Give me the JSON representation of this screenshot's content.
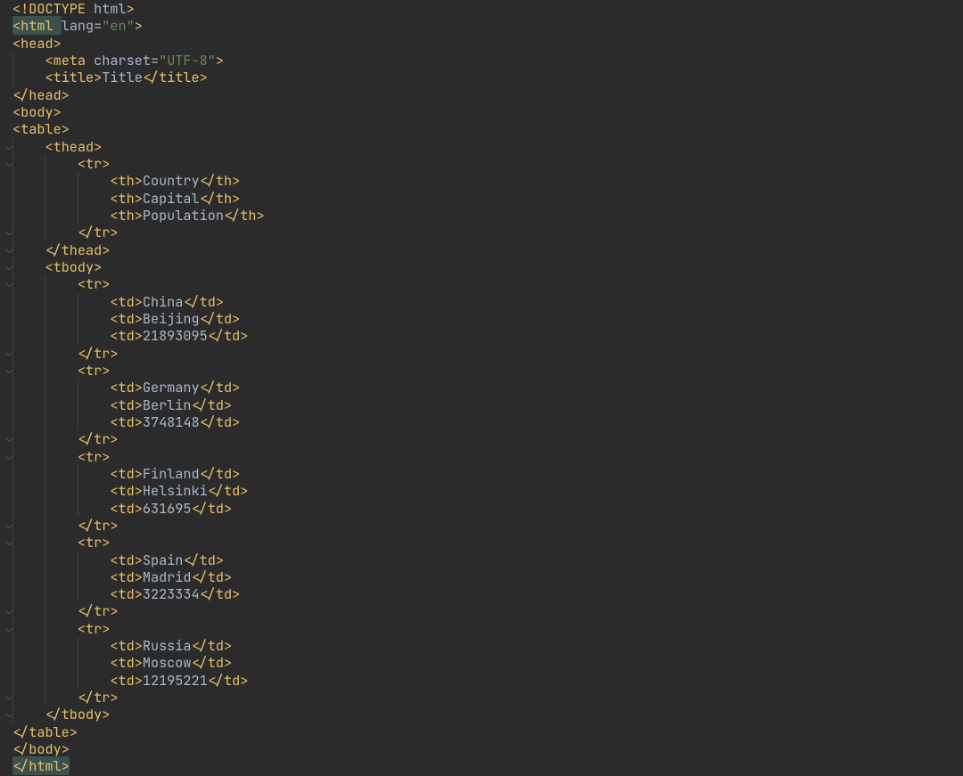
{
  "indentUnit": "    ",
  "lines": [
    {
      "indent": 0,
      "gutter": "",
      "tokens": [
        {
          "cls": "tag-punc",
          "t": "<!"
        },
        {
          "cls": "tag-name",
          "t": "DOCTYPE "
        },
        {
          "cls": "attr-name",
          "t": "html"
        },
        {
          "cls": "tag-punc",
          "t": ">"
        }
      ]
    },
    {
      "indent": 0,
      "gutter": "",
      "tokens": [
        {
          "cls": "hl-open",
          "wrap": [
            {
              "cls": "tag-punc",
              "t": "<"
            },
            {
              "cls": "tag-name",
              "t": "html "
            }
          ]
        },
        {
          "cls": "attr-name",
          "t": "lang"
        },
        {
          "cls": "attr-eq",
          "t": "="
        },
        {
          "cls": "attr-val",
          "t": "\"en\""
        },
        {
          "cls": "tag-punc",
          "t": ">"
        }
      ]
    },
    {
      "indent": 0,
      "gutter": "",
      "tokens": [
        {
          "cls": "tag-punc",
          "t": "<"
        },
        {
          "cls": "tag-name",
          "t": "head"
        },
        {
          "cls": "tag-punc",
          "t": ">"
        }
      ]
    },
    {
      "indent": 1,
      "gutter": "",
      "tokens": [
        {
          "cls": "tag-punc",
          "t": "<"
        },
        {
          "cls": "tag-name",
          "t": "meta "
        },
        {
          "cls": "attr-name",
          "t": "charset"
        },
        {
          "cls": "attr-eq",
          "t": "="
        },
        {
          "cls": "attr-val",
          "t": "\"UTF-8\""
        },
        {
          "cls": "tag-punc",
          "t": ">"
        }
      ]
    },
    {
      "indent": 1,
      "gutter": "",
      "tokens": [
        {
          "cls": "tag-punc",
          "t": "<"
        },
        {
          "cls": "tag-name",
          "t": "title"
        },
        {
          "cls": "tag-punc",
          "t": ">"
        },
        {
          "cls": "text-content",
          "t": "Title"
        },
        {
          "cls": "tag-punc",
          "t": "</"
        },
        {
          "cls": "tag-name",
          "t": "title"
        },
        {
          "cls": "tag-punc",
          "t": ">"
        }
      ]
    },
    {
      "indent": 0,
      "gutter": "",
      "tokens": [
        {
          "cls": "tag-punc",
          "t": "</"
        },
        {
          "cls": "tag-name",
          "t": "head"
        },
        {
          "cls": "tag-punc",
          "t": ">"
        }
      ]
    },
    {
      "indent": 0,
      "gutter": "",
      "tokens": [
        {
          "cls": "tag-punc",
          "t": "<"
        },
        {
          "cls": "tag-name",
          "t": "body"
        },
        {
          "cls": "tag-punc",
          "t": ">"
        }
      ]
    },
    {
      "indent": 0,
      "gutter": "",
      "tokens": [
        {
          "cls": "tag-punc",
          "t": "<"
        },
        {
          "cls": "tag-name",
          "t": "table"
        },
        {
          "cls": "tag-punc",
          "t": ">"
        }
      ]
    },
    {
      "indent": 1,
      "gutter": "⌄",
      "tokens": [
        {
          "cls": "tag-punc",
          "t": "<"
        },
        {
          "cls": "tag-name",
          "t": "thead"
        },
        {
          "cls": "tag-punc",
          "t": ">"
        }
      ]
    },
    {
      "indent": 2,
      "gutter": "⌄",
      "tokens": [
        {
          "cls": "tag-punc",
          "t": "<"
        },
        {
          "cls": "tag-name",
          "t": "tr"
        },
        {
          "cls": "tag-punc",
          "t": ">"
        }
      ]
    },
    {
      "indent": 3,
      "gutter": "",
      "tokens": [
        {
          "cls": "tag-punc",
          "t": "<"
        },
        {
          "cls": "tag-name",
          "t": "th"
        },
        {
          "cls": "tag-punc",
          "t": ">"
        },
        {
          "cls": "text-content",
          "t": "Country"
        },
        {
          "cls": "tag-punc",
          "t": "</"
        },
        {
          "cls": "tag-name",
          "t": "th"
        },
        {
          "cls": "tag-punc",
          "t": ">"
        }
      ]
    },
    {
      "indent": 3,
      "gutter": "",
      "tokens": [
        {
          "cls": "tag-punc",
          "t": "<"
        },
        {
          "cls": "tag-name",
          "t": "th"
        },
        {
          "cls": "tag-punc",
          "t": ">"
        },
        {
          "cls": "text-content",
          "t": "Capital"
        },
        {
          "cls": "tag-punc",
          "t": "</"
        },
        {
          "cls": "tag-name",
          "t": "th"
        },
        {
          "cls": "tag-punc",
          "t": ">"
        }
      ]
    },
    {
      "indent": 3,
      "gutter": "",
      "tokens": [
        {
          "cls": "tag-punc",
          "t": "<"
        },
        {
          "cls": "tag-name",
          "t": "th"
        },
        {
          "cls": "tag-punc",
          "t": ">"
        },
        {
          "cls": "text-content",
          "t": "Population"
        },
        {
          "cls": "tag-punc",
          "t": "</"
        },
        {
          "cls": "tag-name",
          "t": "th"
        },
        {
          "cls": "tag-punc",
          "t": ">"
        }
      ]
    },
    {
      "indent": 2,
      "gutter": "⌄",
      "tokens": [
        {
          "cls": "tag-punc",
          "t": "</"
        },
        {
          "cls": "tag-name",
          "t": "tr"
        },
        {
          "cls": "tag-punc",
          "t": ">"
        }
      ]
    },
    {
      "indent": 1,
      "gutter": "⌄",
      "tokens": [
        {
          "cls": "tag-punc",
          "t": "</"
        },
        {
          "cls": "tag-name",
          "t": "thead"
        },
        {
          "cls": "tag-punc",
          "t": ">"
        }
      ]
    },
    {
      "indent": 1,
      "gutter": "⌄",
      "tokens": [
        {
          "cls": "tag-punc",
          "t": "<"
        },
        {
          "cls": "tag-name",
          "t": "tbody"
        },
        {
          "cls": "tag-punc",
          "t": ">"
        }
      ]
    },
    {
      "indent": 2,
      "gutter": "⌄",
      "tokens": [
        {
          "cls": "tag-punc",
          "t": "<"
        },
        {
          "cls": "tag-name",
          "t": "tr"
        },
        {
          "cls": "tag-punc",
          "t": ">"
        }
      ]
    },
    {
      "indent": 3,
      "gutter": "",
      "tokens": [
        {
          "cls": "tag-punc",
          "t": "<"
        },
        {
          "cls": "tag-name",
          "t": "td"
        },
        {
          "cls": "tag-punc",
          "t": ">"
        },
        {
          "cls": "text-content",
          "t": "China"
        },
        {
          "cls": "tag-punc",
          "t": "</"
        },
        {
          "cls": "tag-name",
          "t": "td"
        },
        {
          "cls": "tag-punc",
          "t": ">"
        }
      ]
    },
    {
      "indent": 3,
      "gutter": "",
      "tokens": [
        {
          "cls": "tag-punc",
          "t": "<"
        },
        {
          "cls": "tag-name",
          "t": "td"
        },
        {
          "cls": "tag-punc",
          "t": ">"
        },
        {
          "cls": "text-content",
          "t": "Beijing"
        },
        {
          "cls": "tag-punc",
          "t": "</"
        },
        {
          "cls": "tag-name",
          "t": "td"
        },
        {
          "cls": "tag-punc",
          "t": ">"
        }
      ]
    },
    {
      "indent": 3,
      "gutter": "",
      "tokens": [
        {
          "cls": "tag-punc",
          "t": "<"
        },
        {
          "cls": "tag-name",
          "t": "td"
        },
        {
          "cls": "tag-punc",
          "t": ">"
        },
        {
          "cls": "text-content",
          "t": "21893095"
        },
        {
          "cls": "tag-punc",
          "t": "</"
        },
        {
          "cls": "tag-name",
          "t": "td"
        },
        {
          "cls": "tag-punc",
          "t": ">"
        }
      ]
    },
    {
      "indent": 2,
      "gutter": "⌄",
      "tokens": [
        {
          "cls": "tag-punc",
          "t": "</"
        },
        {
          "cls": "tag-name",
          "t": "tr"
        },
        {
          "cls": "tag-punc",
          "t": ">"
        }
      ]
    },
    {
      "indent": 2,
      "gutter": "⌄",
      "tokens": [
        {
          "cls": "tag-punc",
          "t": "<"
        },
        {
          "cls": "tag-name",
          "t": "tr"
        },
        {
          "cls": "tag-punc",
          "t": ">"
        }
      ]
    },
    {
      "indent": 3,
      "gutter": "",
      "tokens": [
        {
          "cls": "tag-punc",
          "t": "<"
        },
        {
          "cls": "tag-name",
          "t": "td"
        },
        {
          "cls": "tag-punc",
          "t": ">"
        },
        {
          "cls": "text-content",
          "t": "Germany"
        },
        {
          "cls": "tag-punc",
          "t": "</"
        },
        {
          "cls": "tag-name",
          "t": "td"
        },
        {
          "cls": "tag-punc",
          "t": ">"
        }
      ]
    },
    {
      "indent": 3,
      "gutter": "",
      "tokens": [
        {
          "cls": "tag-punc",
          "t": "<"
        },
        {
          "cls": "tag-name",
          "t": "td"
        },
        {
          "cls": "tag-punc",
          "t": ">"
        },
        {
          "cls": "text-content",
          "t": "Berlin"
        },
        {
          "cls": "tag-punc",
          "t": "</"
        },
        {
          "cls": "tag-name",
          "t": "td"
        },
        {
          "cls": "tag-punc",
          "t": ">"
        }
      ]
    },
    {
      "indent": 3,
      "gutter": "",
      "tokens": [
        {
          "cls": "tag-punc",
          "t": "<"
        },
        {
          "cls": "tag-name",
          "t": "td"
        },
        {
          "cls": "tag-punc",
          "t": ">"
        },
        {
          "cls": "text-content",
          "t": "3748148"
        },
        {
          "cls": "tag-punc",
          "t": "</"
        },
        {
          "cls": "tag-name",
          "t": "td"
        },
        {
          "cls": "tag-punc",
          "t": ">"
        }
      ]
    },
    {
      "indent": 2,
      "gutter": "⌄",
      "tokens": [
        {
          "cls": "tag-punc",
          "t": "</"
        },
        {
          "cls": "tag-name",
          "t": "tr"
        },
        {
          "cls": "tag-punc",
          "t": ">"
        }
      ]
    },
    {
      "indent": 2,
      "gutter": "⌄",
      "tokens": [
        {
          "cls": "tag-punc",
          "t": "<"
        },
        {
          "cls": "tag-name",
          "t": "tr"
        },
        {
          "cls": "tag-punc",
          "t": ">"
        }
      ]
    },
    {
      "indent": 3,
      "gutter": "",
      "tokens": [
        {
          "cls": "tag-punc",
          "t": "<"
        },
        {
          "cls": "tag-name",
          "t": "td"
        },
        {
          "cls": "tag-punc",
          "t": ">"
        },
        {
          "cls": "text-content",
          "t": "Finland"
        },
        {
          "cls": "tag-punc",
          "t": "</"
        },
        {
          "cls": "tag-name",
          "t": "td"
        },
        {
          "cls": "tag-punc",
          "t": ">"
        }
      ]
    },
    {
      "indent": 3,
      "gutter": "",
      "tokens": [
        {
          "cls": "tag-punc",
          "t": "<"
        },
        {
          "cls": "tag-name",
          "t": "td"
        },
        {
          "cls": "tag-punc",
          "t": ">"
        },
        {
          "cls": "text-content",
          "t": "Helsinki"
        },
        {
          "cls": "tag-punc",
          "t": "</"
        },
        {
          "cls": "tag-name",
          "t": "td"
        },
        {
          "cls": "tag-punc",
          "t": ">"
        }
      ]
    },
    {
      "indent": 3,
      "gutter": "",
      "tokens": [
        {
          "cls": "tag-punc",
          "t": "<"
        },
        {
          "cls": "tag-name",
          "t": "td"
        },
        {
          "cls": "tag-punc",
          "t": ">"
        },
        {
          "cls": "text-content",
          "t": "631695"
        },
        {
          "cls": "tag-punc",
          "t": "</"
        },
        {
          "cls": "tag-name",
          "t": "td"
        },
        {
          "cls": "tag-punc",
          "t": ">"
        }
      ]
    },
    {
      "indent": 2,
      "gutter": "⌄",
      "tokens": [
        {
          "cls": "tag-punc",
          "t": "</"
        },
        {
          "cls": "tag-name",
          "t": "tr"
        },
        {
          "cls": "tag-punc",
          "t": ">"
        }
      ]
    },
    {
      "indent": 2,
      "gutter": "⌄",
      "tokens": [
        {
          "cls": "tag-punc",
          "t": "<"
        },
        {
          "cls": "tag-name",
          "t": "tr"
        },
        {
          "cls": "tag-punc",
          "t": ">"
        }
      ]
    },
    {
      "indent": 3,
      "gutter": "",
      "tokens": [
        {
          "cls": "tag-punc",
          "t": "<"
        },
        {
          "cls": "tag-name",
          "t": "td"
        },
        {
          "cls": "tag-punc",
          "t": ">"
        },
        {
          "cls": "text-content",
          "t": "Spain"
        },
        {
          "cls": "tag-punc",
          "t": "</"
        },
        {
          "cls": "tag-name",
          "t": "td"
        },
        {
          "cls": "tag-punc",
          "t": ">"
        }
      ]
    },
    {
      "indent": 3,
      "gutter": "",
      "tokens": [
        {
          "cls": "tag-punc",
          "t": "<"
        },
        {
          "cls": "tag-name",
          "t": "td"
        },
        {
          "cls": "tag-punc",
          "t": ">"
        },
        {
          "cls": "text-content",
          "t": "Madrid"
        },
        {
          "cls": "tag-punc",
          "t": "</"
        },
        {
          "cls": "tag-name",
          "t": "td"
        },
        {
          "cls": "tag-punc",
          "t": ">"
        }
      ]
    },
    {
      "indent": 3,
      "gutter": "",
      "tokens": [
        {
          "cls": "tag-punc",
          "t": "<"
        },
        {
          "cls": "tag-name",
          "t": "td"
        },
        {
          "cls": "tag-punc",
          "t": ">"
        },
        {
          "cls": "text-content",
          "t": "3223334"
        },
        {
          "cls": "tag-punc",
          "t": "</"
        },
        {
          "cls": "tag-name",
          "t": "td"
        },
        {
          "cls": "tag-punc",
          "t": ">"
        }
      ]
    },
    {
      "indent": 2,
      "gutter": "⌄",
      "tokens": [
        {
          "cls": "tag-punc",
          "t": "</"
        },
        {
          "cls": "tag-name",
          "t": "tr"
        },
        {
          "cls": "tag-punc",
          "t": ">"
        }
      ]
    },
    {
      "indent": 2,
      "gutter": "⌄",
      "tokens": [
        {
          "cls": "tag-punc",
          "t": "<"
        },
        {
          "cls": "tag-name",
          "t": "tr"
        },
        {
          "cls": "tag-punc",
          "t": ">"
        }
      ]
    },
    {
      "indent": 3,
      "gutter": "",
      "tokens": [
        {
          "cls": "tag-punc",
          "t": "<"
        },
        {
          "cls": "tag-name",
          "t": "td"
        },
        {
          "cls": "tag-punc",
          "t": ">"
        },
        {
          "cls": "text-content",
          "t": "Russia"
        },
        {
          "cls": "tag-punc",
          "t": "</"
        },
        {
          "cls": "tag-name",
          "t": "td"
        },
        {
          "cls": "tag-punc",
          "t": ">"
        }
      ]
    },
    {
      "indent": 3,
      "gutter": "",
      "tokens": [
        {
          "cls": "tag-punc",
          "t": "<"
        },
        {
          "cls": "tag-name",
          "t": "td"
        },
        {
          "cls": "tag-punc",
          "t": ">"
        },
        {
          "cls": "text-content",
          "t": "Moscow"
        },
        {
          "cls": "tag-punc",
          "t": "</"
        },
        {
          "cls": "tag-name",
          "t": "td"
        },
        {
          "cls": "tag-punc",
          "t": ">"
        }
      ]
    },
    {
      "indent": 3,
      "gutter": "",
      "tokens": [
        {
          "cls": "tag-punc",
          "t": "<"
        },
        {
          "cls": "tag-name",
          "t": "td"
        },
        {
          "cls": "tag-punc",
          "t": ">"
        },
        {
          "cls": "text-content",
          "t": "12195221"
        },
        {
          "cls": "tag-punc",
          "t": "</"
        },
        {
          "cls": "tag-name",
          "t": "td"
        },
        {
          "cls": "tag-punc",
          "t": ">"
        }
      ]
    },
    {
      "indent": 2,
      "gutter": "⌄",
      "tokens": [
        {
          "cls": "tag-punc",
          "t": "</"
        },
        {
          "cls": "tag-name",
          "t": "tr"
        },
        {
          "cls": "tag-punc",
          "t": ">"
        }
      ]
    },
    {
      "indent": 1,
      "gutter": "⌄",
      "tokens": [
        {
          "cls": "tag-punc",
          "t": "</"
        },
        {
          "cls": "tag-name",
          "t": "tbody"
        },
        {
          "cls": "tag-punc",
          "t": ">"
        }
      ]
    },
    {
      "indent": 0,
      "gutter": "",
      "tokens": [
        {
          "cls": "tag-punc",
          "t": "</"
        },
        {
          "cls": "tag-name",
          "t": "table"
        },
        {
          "cls": "tag-punc",
          "t": ">"
        }
      ]
    },
    {
      "indent": 0,
      "gutter": "",
      "tokens": [
        {
          "cls": "tag-punc",
          "t": "</"
        },
        {
          "cls": "tag-name",
          "t": "body"
        },
        {
          "cls": "tag-punc",
          "t": ">"
        }
      ]
    },
    {
      "indent": 0,
      "gutter": "",
      "tokens": [
        {
          "cls": "hl-close",
          "wrap": [
            {
              "cls": "tag-punc",
              "t": "</"
            },
            {
              "cls": "tag-name",
              "t": "html"
            },
            {
              "cls": "tag-punc",
              "t": ">"
            }
          ]
        }
      ]
    }
  ],
  "chart_data": {
    "type": "table",
    "title": "Title",
    "columns": [
      "Country",
      "Capital",
      "Population"
    ],
    "rows": [
      [
        "China",
        "Beijing",
        21893095
      ],
      [
        "Germany",
        "Berlin",
        3748148
      ],
      [
        "Finland",
        "Helsinki",
        631695
      ],
      [
        "Spain",
        "Madrid",
        3223334
      ],
      [
        "Russia",
        "Moscow",
        12195221
      ]
    ]
  }
}
